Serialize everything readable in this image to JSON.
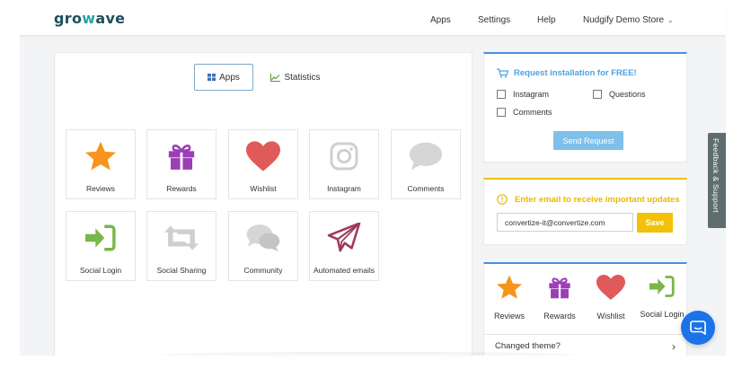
{
  "header": {
    "logo_left": "gro",
    "logo_w": "w",
    "logo_right": "ave",
    "nav": {
      "apps": "Apps",
      "settings": "Settings",
      "help": "Help",
      "store": "Nudgify Demo Store"
    }
  },
  "tabs": {
    "apps": "Apps",
    "statistics": "Statistics"
  },
  "apps": [
    {
      "label": "Reviews",
      "icon": "star-icon"
    },
    {
      "label": "Rewards",
      "icon": "gift-icon"
    },
    {
      "label": "Wishlist",
      "icon": "heart-icon"
    },
    {
      "label": "Instagram",
      "icon": "instagram-icon"
    },
    {
      "label": "Comments",
      "icon": "comment-bubble-icon"
    },
    {
      "label": "Social Login",
      "icon": "login-arrow-icon"
    },
    {
      "label": "Social Sharing",
      "icon": "repeat-icon"
    },
    {
      "label": "Community",
      "icon": "chat-bubbles-icon"
    },
    {
      "label": "Automated emails",
      "icon": "paper-plane-icon"
    }
  ],
  "request": {
    "title": "Request installation for FREE!",
    "options": [
      "Instagram",
      "Questions",
      "Comments"
    ],
    "button": "Send Request"
  },
  "email": {
    "title": "Enter email to receive important updates",
    "value": "convertize-it@convertize.com",
    "button": "Save"
  },
  "theme": {
    "items": [
      "Reviews",
      "Rewards",
      "Wishlist",
      "Social Login"
    ],
    "question": "Changed theme?"
  },
  "feedback": "Feedback & Support",
  "colors": {
    "accent_blue": "#4a90d9",
    "accent_yellow": "#f3c108",
    "star": "#f7941d",
    "gift": "#9b3fb5",
    "heart": "#e05a5a",
    "login": "#7ab648"
  }
}
